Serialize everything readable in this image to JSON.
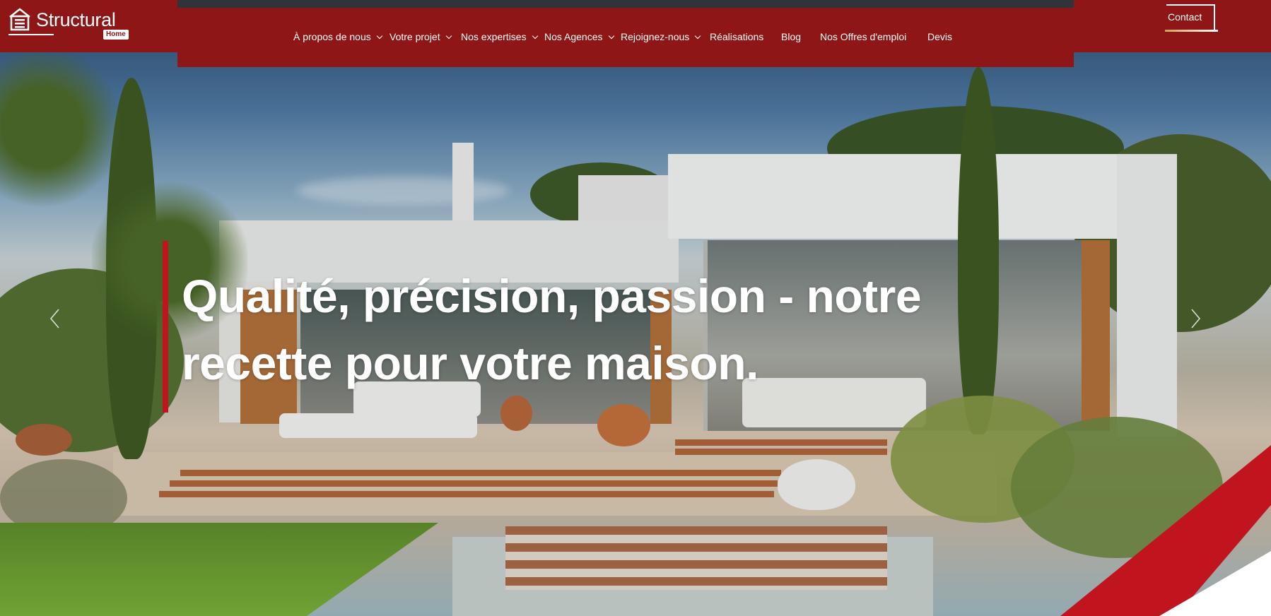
{
  "brand": {
    "name": "Structural",
    "sub": "Home",
    "primary_color": "#8e1617",
    "accent_color": "#c0151f"
  },
  "nav": {
    "items": [
      {
        "label": "À propos de nous",
        "has_dropdown": true
      },
      {
        "label": "Votre projet",
        "has_dropdown": true
      },
      {
        "label": "Nos expertises",
        "has_dropdown": true
      },
      {
        "label": "Nos Agences",
        "has_dropdown": true
      },
      {
        "label": "Rejoignez-nous",
        "has_dropdown": true
      },
      {
        "label": "Réalisations",
        "has_dropdown": false
      },
      {
        "label": "Blog",
        "has_dropdown": false
      },
      {
        "label": "Nos Offres d'emploi",
        "has_dropdown": false
      },
      {
        "label": "Devis",
        "has_dropdown": false
      }
    ],
    "contact_label": "Contact"
  },
  "hero": {
    "headline_line1": "Qualité, précision, passion - notre",
    "headline_line2": "recette pour votre maison.",
    "prev_icon": "chevron-left-icon",
    "next_icon": "chevron-right-icon"
  }
}
